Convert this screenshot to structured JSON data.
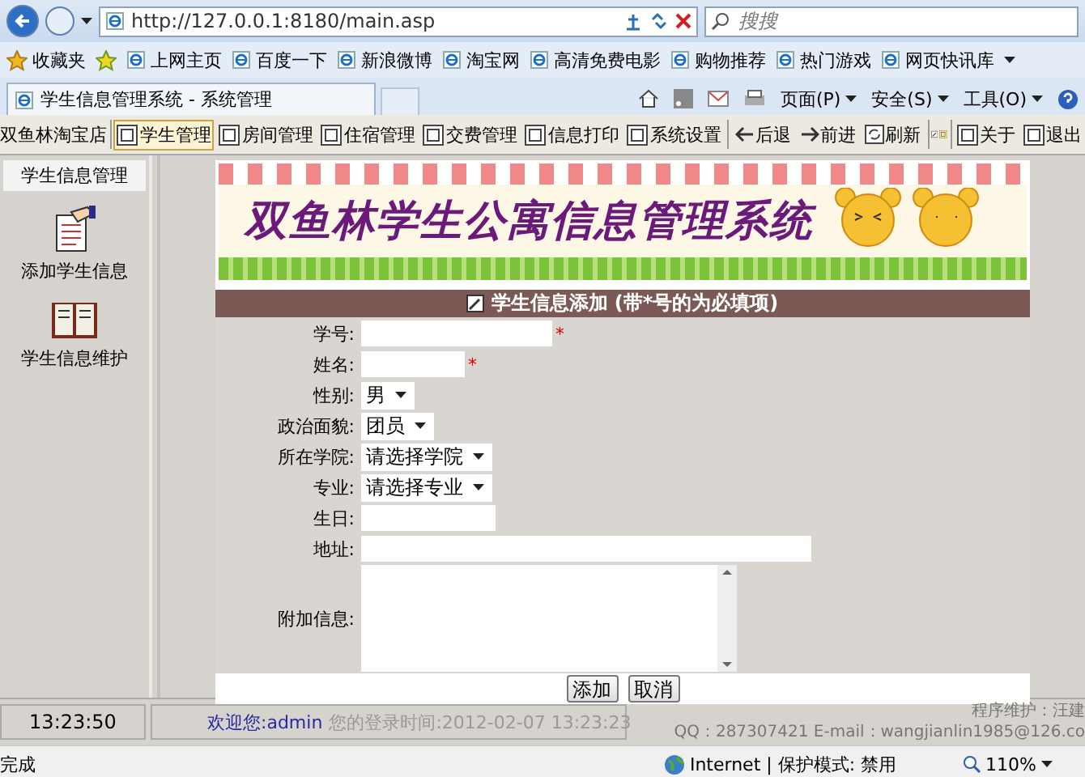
{
  "browser": {
    "address": "http://127.0.0.1:8180/main.asp",
    "search_placeholder": "搜搜",
    "favorites_label": "收藏夹",
    "favorites": [
      "上网主页",
      "百度一下",
      "新浪微博",
      "淘宝网",
      "高清免费电影",
      "购物推荐",
      "热门游戏",
      "网页快讯库"
    ],
    "tab_title": "学生信息管理系统 - 系统管理",
    "commands": [
      "页面(P)",
      "安全(S)",
      "工具(O)"
    ]
  },
  "app_toolbar": {
    "shop": "双鱼林淘宝店",
    "menu": [
      {
        "label": "学生管理",
        "selected": true
      },
      {
        "label": "房间管理",
        "selected": false
      },
      {
        "label": "住宿管理",
        "selected": false
      },
      {
        "label": "交费管理",
        "selected": false
      },
      {
        "label": "信息打印",
        "selected": false
      },
      {
        "label": "系统设置",
        "selected": false
      }
    ],
    "nav": [
      {
        "kind": "back",
        "label": "后退"
      },
      {
        "kind": "forward",
        "label": "前进"
      },
      {
        "kind": "refresh",
        "label": "刷新"
      }
    ],
    "right": [
      "关于",
      "退出"
    ]
  },
  "sidebar": {
    "title": "学生信息管理",
    "items": [
      {
        "kind": "add",
        "label": "添加学生信息"
      },
      {
        "kind": "book",
        "label": "学生信息维护"
      }
    ]
  },
  "banner": {
    "title": "双鱼林学生公寓信息管理系统"
  },
  "form": {
    "heading": "学生信息添加",
    "note": "(带*号的为必填项)",
    "fields": [
      {
        "label": "学号:",
        "kind": "text",
        "required_mark": "*"
      },
      {
        "label": "姓名:",
        "kind": "text",
        "required_mark": "*"
      },
      {
        "label": "性别:",
        "kind": "select",
        "value": "男"
      },
      {
        "label": "政治面貌:",
        "kind": "select",
        "value": "团员"
      },
      {
        "label": "所在学院:",
        "kind": "select",
        "value": "请选择学院"
      },
      {
        "label": "专业:",
        "kind": "select",
        "value": "请选择专业"
      },
      {
        "label": "生日:",
        "kind": "text"
      },
      {
        "label": "地址:",
        "kind": "text"
      },
      {
        "label": "附加信息:",
        "kind": "textarea"
      }
    ],
    "buttons": [
      "添加",
      "取消"
    ]
  },
  "status": {
    "time": "13:23:50",
    "welcome": "欢迎您:admin",
    "login": "您的登录时间:2012-02-07 13:23:23",
    "maintainer": "程序维护：汪建",
    "contact": "QQ：287307421 E-mail：wangjianlin1985@126.co"
  },
  "ie_status": {
    "text": "完成",
    "zone": "Internet | 保护模式: 禁用",
    "zoom": "110%"
  }
}
